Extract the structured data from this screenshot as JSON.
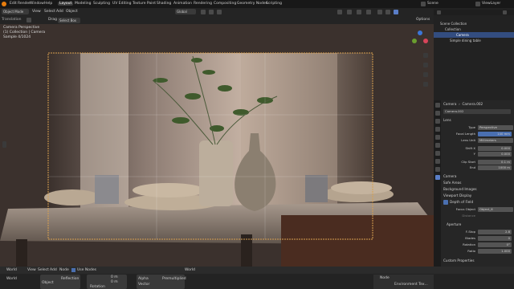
{
  "topbar": {
    "menus": [
      "Edit",
      "Render",
      "Window",
      "Help"
    ],
    "workspaces": [
      "Layout",
      "Modeling",
      "Sculpting",
      "UV Editing",
      "Texture Paint",
      "Shading",
      "Animation",
      "Rendering",
      "Compositing",
      "Geometry Nodes",
      "Scripting"
    ],
    "scene": "Scene",
    "view_layer": "ViewLayer"
  },
  "viewport_header": {
    "mode": "Object Mode",
    "menus": [
      "View",
      "Select",
      "Add",
      "Object"
    ],
    "orientation": "Global",
    "options": "Options"
  },
  "tool_header": {
    "transform": "Translation",
    "drag": "Drag",
    "select": "Select Box"
  },
  "overlay_text": {
    "line1": "Camera Perspective",
    "line2": "(1) Collection | Camera",
    "line3": "Sample 4/1024"
  },
  "outliner": {
    "rows": [
      "Scene Collection",
      "Collection",
      "Camera",
      "Simple dining table"
    ]
  },
  "properties": {
    "object": "Camera",
    "data": "Camera.002",
    "data_name": "Camera.002",
    "lens_header": "Lens",
    "type_label": "Type",
    "type_value": "Perspective",
    "focal_label": "Focal Length",
    "focal_value": "140 mm",
    "lens_unit_label": "Lens Unit",
    "lens_unit_value": "Millimeters",
    "shiftx_label": "Shift X",
    "shiftx_value": "0.000",
    "shifty_label": "Y",
    "shifty_value": "0.000",
    "clipstart_label": "Clip Start",
    "clipstart_value": "0.1 m",
    "clipend_label": "End",
    "clipend_value": "1000 m",
    "camera_header": "Camera",
    "safe_areas": "Safe Areas",
    "background_images": "Background Images",
    "viewport_display": "Viewport Display",
    "dof": "Depth of Field",
    "focus_object_label": "Focus Object",
    "focus_object_value": "Object_6",
    "distance_label": "Distance",
    "aperture_header": "Aperture",
    "fstop_label": "F-Stop",
    "fstop_value": "2.8",
    "blades_label": "Blades",
    "blades_value": "0",
    "rotation_label": "Rotation",
    "rotation_value": "0°",
    "ratio_label": "Ratio",
    "ratio_value": "1.000",
    "custom_props": "Custom Properties"
  },
  "bottom": {
    "world1": "World",
    "menus": [
      "View",
      "Select",
      "Add",
      "Node"
    ],
    "use_nodes": "Use Nodes",
    "world2": "World",
    "object_label": "Object",
    "reflection": "Reflection",
    "loc1": "0 m",
    "loc2": "0 m",
    "rotation": "Rotation",
    "alpha": "Alpha",
    "vector": "Vector",
    "premultiplied": "Premultiplied",
    "world3": "World",
    "node": "Node",
    "env_tex": "Environment Tex..."
  }
}
